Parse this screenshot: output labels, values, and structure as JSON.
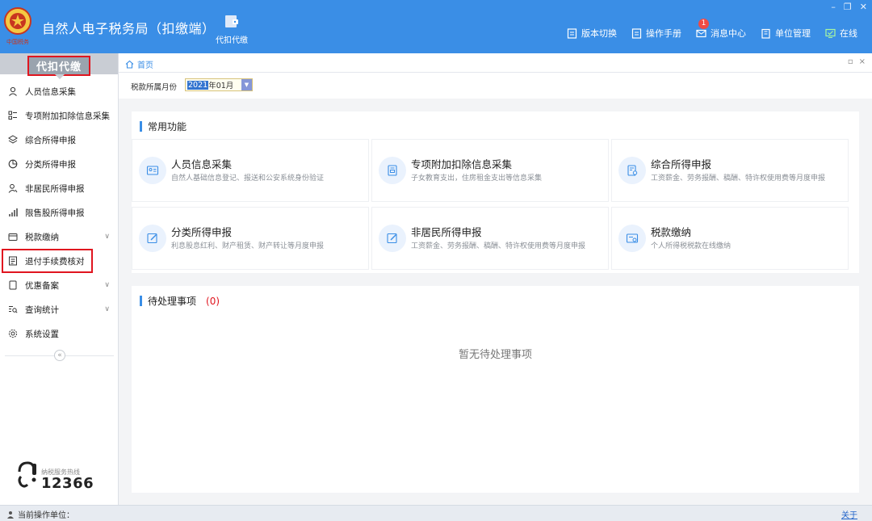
{
  "app": {
    "title": "自然人电子税务局（扣缴端）",
    "logo_text": "中国税务"
  },
  "main_nav": {
    "label": "代扣代缴"
  },
  "header_actions": {
    "version": "版本切换",
    "manual": "操作手册",
    "messages": "消息中心",
    "messages_badge": "1",
    "org": "单位管理",
    "status": "在线"
  },
  "window_controls": {
    "minimize": "–",
    "restore": "❐",
    "close": "✕"
  },
  "sidebar": {
    "title": "代扣代缴",
    "items": [
      {
        "label": "人员信息采集",
        "icon": "user-icon"
      },
      {
        "label": "专项附加扣除信息采集",
        "icon": "list-icon"
      },
      {
        "label": "综合所得申报",
        "icon": "layers-icon"
      },
      {
        "label": "分类所得申报",
        "icon": "pie-icon"
      },
      {
        "label": "非居民所得申报",
        "icon": "person-icon"
      },
      {
        "label": "限售股所得申报",
        "icon": "bar-chart-icon"
      },
      {
        "label": "税款缴纳",
        "icon": "wallet-icon",
        "expand": "∨"
      },
      {
        "label": "退付手续费核对",
        "icon": "doc-icon"
      },
      {
        "label": "优惠备案",
        "icon": "file-icon",
        "expand": "∨"
      },
      {
        "label": "查询统计",
        "icon": "search-list-icon",
        "expand": "∨"
      },
      {
        "label": "系统设置",
        "icon": "gear-icon"
      }
    ],
    "collapse": "«",
    "hotline_label": "纳税服务热线",
    "hotline_number": "12366"
  },
  "tabs": {
    "home": "首页"
  },
  "tab_controls": {
    "restore": "▫",
    "close": "×"
  },
  "filter": {
    "label": "税款所属月份",
    "year": "2021",
    "month": "年01月",
    "dropdown": "▼"
  },
  "common": {
    "title": "常用功能",
    "cards": [
      {
        "title": "人员信息采集",
        "desc": "自然人基础信息登记、报送和公安系统身份验证"
      },
      {
        "title": "专项附加扣除信息采集",
        "desc": "子女教育支出，住房租金支出等信息采集"
      },
      {
        "title": "综合所得申报",
        "desc": "工资薪金、劳务报酬、稿酬、特许权使用费等月度申报"
      },
      {
        "title": "分类所得申报",
        "desc": "利息股息红利、财产租赁、财产转让等月度申报"
      },
      {
        "title": "非居民所得申报",
        "desc": "工资薪金、劳务报酬、稿酬、特许权使用费等月度申报"
      },
      {
        "title": "税款缴纳",
        "desc": "个人所得税税款在线缴纳"
      }
    ]
  },
  "pending": {
    "title": "待处理事项",
    "count": "(0)",
    "empty": "暂无待处理事项"
  },
  "status_bar": {
    "current_unit_label": "当前操作单位：",
    "about": "关于"
  },
  "colors": {
    "header": "#3a8ee6",
    "highlight_red": "#e0151f",
    "sidebar_title": "#c9cdd4"
  }
}
